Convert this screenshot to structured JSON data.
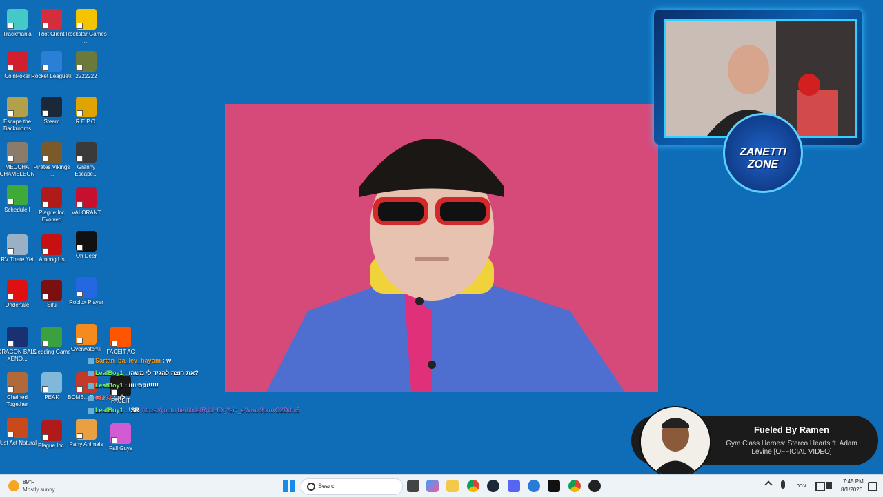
{
  "desktop": {
    "icons": [
      {
        "label": "Trackmania",
        "color": "#44c8c8"
      },
      {
        "label": "Riot Client",
        "color": "#d42d3c"
      },
      {
        "label": "Rockstar Games ...",
        "color": "#f5c400"
      },
      {
        "label": "CoinPoker",
        "color": "#d21f2f"
      },
      {
        "label": "Rocket League®",
        "color": "#2a7fd6"
      },
      {
        "label": "2222222",
        "color": "#6b7a3a"
      },
      {
        "label": "Escape the Backrooms",
        "color": "#b2a04a"
      },
      {
        "label": "Steam",
        "color": "#1b2838"
      },
      {
        "label": "R.E.P.O.",
        "color": "#e0a400"
      },
      {
        "label": "MECCHA CHAMELEON",
        "color": "#8b7b6a"
      },
      {
        "label": "Pirates Vikings ...",
        "color": "#7a5a2a"
      },
      {
        "label": "Granny Escape...",
        "color": "#3a3a3a"
      },
      {
        "label": "Schedule I",
        "color": "#3faa3a"
      },
      {
        "label": "Plague Inc Evolved",
        "color": "#b01a1a"
      },
      {
        "label": "VALORANT",
        "color": "#c7102e"
      },
      {
        "label": "RV There Yet",
        "color": "#9ab0c4"
      },
      {
        "label": "Among Us",
        "color": "#c51111"
      },
      {
        "label": "Oh Deer",
        "color": "#111111"
      },
      {
        "label": "Undertale",
        "color": "#e01010"
      },
      {
        "label": "Sifu",
        "color": "#7a1010"
      },
      {
        "label": "Roblox Player",
        "color": "#2467e0"
      },
      {
        "label": "DRAGON BALL XENO...",
        "color": "#1a3070"
      },
      {
        "label": "Sledding Game",
        "color": "#3aa040"
      },
      {
        "label": "Overwatch®",
        "color": "#f58a1f"
      },
      {
        "label": "FACEIT AC",
        "color": "#ff5500"
      },
      {
        "label": "Chained Together",
        "color": "#b06a3a"
      },
      {
        "label": "PEAK",
        "color": "#7fb8d8"
      },
      {
        "label": "BOMB... Demo",
        "color": "#c23a2a"
      },
      {
        "label": "FACEIT",
        "color": "#1a1a1a"
      },
      {
        "label": "Just Act Natural",
        "color": "#c84a1a"
      },
      {
        "label": "Plague Inc.",
        "color": "#b01a1a"
      },
      {
        "label": "Party Animals",
        "color": "#e8a040"
      },
      {
        "label": "Fall Guys",
        "color": "#d25ad2"
      }
    ]
  },
  "chat": [
    {
      "user": "Sartan_ba_lev_hayom",
      "user_color": "#f0a030",
      "message": ": w"
    },
    {
      "user": "LeafBoy1",
      "user_color": "#7cf060",
      "message": ": את רוצה להגיד לי משהו?"
    },
    {
      "user": "LeafBoy1",
      "user_color": "#7cf060",
      "message": ": וקסיוווו!!!!!"
    },
    {
      "user": "rd193",
      "user_color": "#f06060",
      "message": ": לא"
    },
    {
      "user": "LeafBoy1",
      "user_color": "#7cf060",
      "message": ": !SR",
      "link": "https://youtu.be/bbdsIR4UHDg?si=_eWwol9omxO2Ddm5"
    }
  ],
  "now_playing": {
    "title": "Fueled By Ramen",
    "subtitle": "Gym Class Heroes: Stereo Hearts ft. Adam Levine [OFFICIAL VIDEO]"
  },
  "overlay": {
    "brand": "ZANETTI ZONE"
  },
  "taskbar": {
    "weather_temp": "89°F",
    "weather_desc": "Mostly sunny",
    "search_placeholder": "Search",
    "language": "עבר",
    "time": "7:45 PM",
    "date": "8/1/2026"
  }
}
